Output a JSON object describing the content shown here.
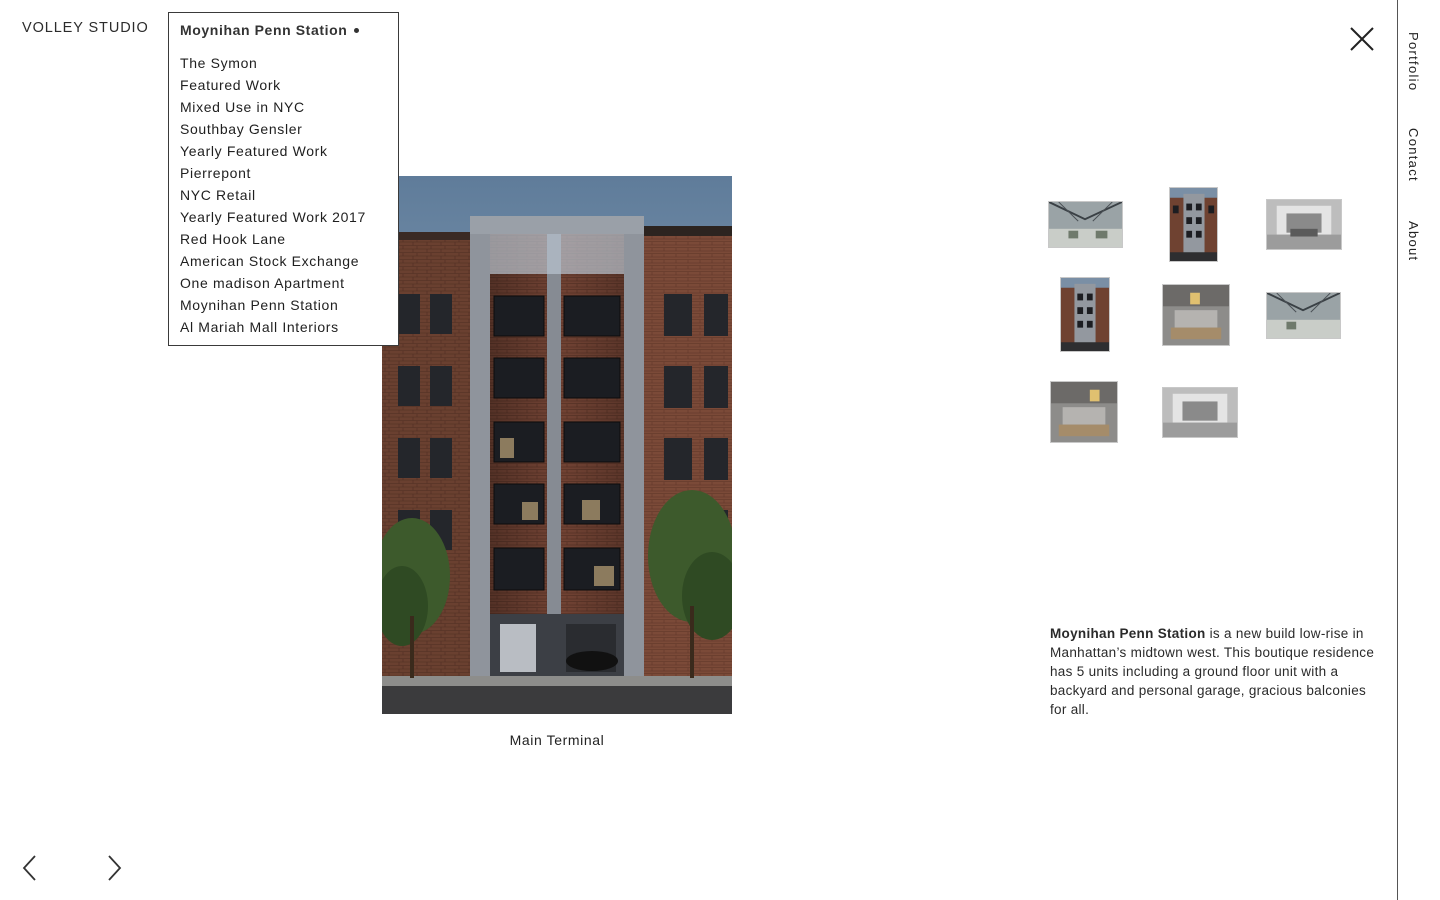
{
  "brand": "VOLLEY STUDIO",
  "project_menu": {
    "current": "Moynihan Penn Station",
    "items": [
      "The Symon",
      "Featured Work",
      "Mixed Use in NYC",
      "Southbay Gensler",
      "Yearly Featured Work",
      "Pierrepont",
      "NYC Retail",
      "Yearly Featured Work 2017",
      "Red Hook Lane",
      "American Stock Exchange",
      "One madison Apartment",
      "Moynihan Penn Station",
      "Al Mariah Mall Interiors"
    ]
  },
  "hero": {
    "caption": "Main Terminal"
  },
  "side_nav": [
    "Portfolio",
    "Contact",
    "About"
  ],
  "description": {
    "title": "Moynihan Penn Station",
    "body": " is a new build low-rise in Manhattan’s midtown west.  This boutique residence has 5 units including a ground floor unit with a backyard and personal garage, gracious balconies for all."
  },
  "icons": {
    "close": "close-icon",
    "prev": "chevron-left-icon",
    "next": "chevron-right-icon"
  },
  "colors": {
    "text": "#1e1e1e",
    "border": "#3a3a3a",
    "brick": "#6b3f2e",
    "sky": "#6e8aa6"
  }
}
